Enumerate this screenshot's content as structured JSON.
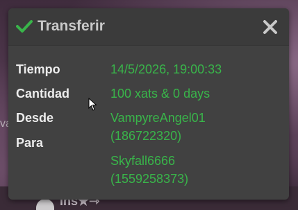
{
  "background": {
    "partial_text": "ins★⇾"
  },
  "dialog": {
    "title": "Transferir",
    "icons": {
      "title_icon": "check-icon",
      "close": "close-icon"
    },
    "colors": {
      "accent": "#39b54a",
      "title": "#c9c9c9",
      "label": "#ececec",
      "panel": "#414141"
    },
    "rows": [
      {
        "label": "Tiempo",
        "value": "14/5/2026, 19:00:33"
      },
      {
        "label": "Cantidad",
        "value": "100 xats & 0 days"
      },
      {
        "label": "Desde",
        "value_line1": "VampyreAngel01",
        "value_line2": "(186722320)"
      },
      {
        "label": "Para",
        "value_line1": "Skyfall6666",
        "value_line2": "(1559258373)"
      }
    ]
  }
}
